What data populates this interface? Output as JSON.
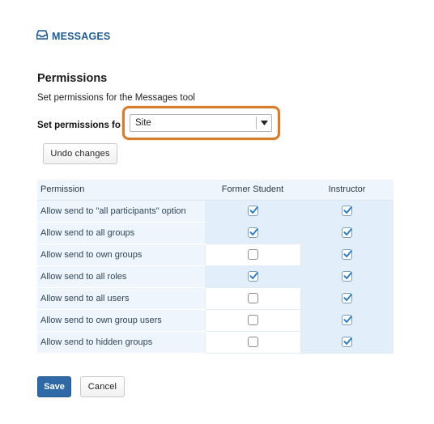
{
  "tool": {
    "icon": "inbox-tray-icon",
    "title": "MESSAGES",
    "color": "#1f5b93"
  },
  "permissions": {
    "heading": "Permissions",
    "description": "Set permissions for the Messages tool",
    "set_for_label": "Set permissions fo",
    "select_value": "Site",
    "highlight_color": "#d97c2a",
    "undo_label": "Undo changes"
  },
  "table": {
    "headers": [
      "Permission",
      "Former Student",
      "Instructor"
    ],
    "rows": [
      {
        "label": "Allow send to \"all participants\" option",
        "former_student": true,
        "instructor": true
      },
      {
        "label": "Allow send to all groups",
        "former_student": true,
        "instructor": true
      },
      {
        "label": "Allow send to own groups",
        "former_student": false,
        "instructor": true
      },
      {
        "label": "Allow send to all roles",
        "former_student": true,
        "instructor": true
      },
      {
        "label": "Allow send to all users",
        "former_student": false,
        "instructor": true
      },
      {
        "label": "Allow send to own group users",
        "former_student": false,
        "instructor": true
      },
      {
        "label": "Allow send to hidden groups",
        "former_student": false,
        "instructor": true
      }
    ]
  },
  "actions": {
    "save_label": "Save",
    "cancel_label": "Cancel",
    "primary_color": "#2f6aa6"
  }
}
